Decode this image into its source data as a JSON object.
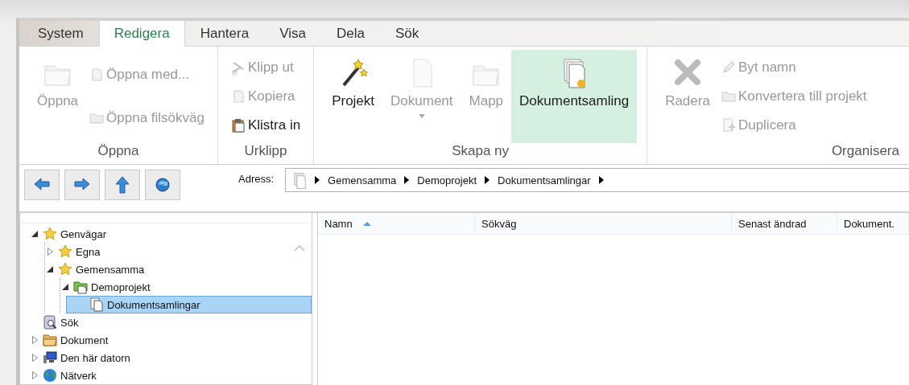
{
  "tabs": [
    {
      "label": "System",
      "selected": false
    },
    {
      "label": "Redigera",
      "selected": true
    },
    {
      "label": "Hantera",
      "selected": false
    },
    {
      "label": "Visa",
      "selected": false
    },
    {
      "label": "Dela",
      "selected": false
    },
    {
      "label": "Sök",
      "selected": false
    }
  ],
  "ribbon": {
    "groups": [
      {
        "label": "Öppna",
        "items": [
          {
            "kind": "large",
            "label": "Öppna",
            "disabled": true
          },
          {
            "kind": "stack",
            "items": [
              {
                "label": "Öppna med...",
                "disabled": true
              },
              {
                "label": "Öppna filsökväg",
                "disabled": true
              }
            ]
          }
        ]
      },
      {
        "label": "Urklipp",
        "items": [
          {
            "kind": "stack",
            "items": [
              {
                "label": "Klipp ut",
                "disabled": true
              },
              {
                "label": "Kopiera",
                "disabled": true
              },
              {
                "label": "Klistra in",
                "disabled": false
              }
            ]
          }
        ]
      },
      {
        "label": "Skapa ny",
        "items": [
          {
            "kind": "large",
            "label": "Projekt",
            "disabled": false,
            "selected": false
          },
          {
            "kind": "large",
            "label": "Dokument",
            "disabled": true,
            "selected": false,
            "dropdown": true
          },
          {
            "kind": "large",
            "label": "Mapp",
            "disabled": true,
            "selected": false
          },
          {
            "kind": "large",
            "label": "Dokumentsamling",
            "disabled": false,
            "selected": true
          }
        ]
      },
      {
        "label": "Organisera",
        "items": [
          {
            "kind": "large",
            "label": "Radera",
            "disabled": true
          },
          {
            "kind": "stack",
            "items": [
              {
                "label": "Byt namn",
                "disabled": true
              },
              {
                "label": "Konvertera till projekt",
                "disabled": true
              },
              {
                "label": "Duplicera",
                "disabled": true
              }
            ]
          }
        ]
      }
    ]
  },
  "address": {
    "label": "Adress:",
    "crumbs": [
      "Gemensamma",
      "Demoprojekt",
      "Dokumentsamlingar"
    ]
  },
  "tree": [
    {
      "label": "Genvägar",
      "expanded": true,
      "selected": false,
      "children": [
        {
          "label": "Egna",
          "expanded": false,
          "selected": false
        },
        {
          "label": "Gemensamma",
          "expanded": true,
          "selected": false,
          "children": [
            {
              "label": "Demoprojekt",
              "expanded": true,
              "selected": false,
              "children": [
                {
                  "label": "Dokumentsamlingar",
                  "selected": true
                }
              ]
            }
          ]
        }
      ]
    },
    {
      "label": "Sök",
      "selected": false
    },
    {
      "label": "Dokument",
      "expanded": false,
      "selected": false
    },
    {
      "label": "Den här datorn",
      "expanded": false,
      "selected": false
    },
    {
      "label": "Nätverk",
      "expanded": false,
      "selected": false
    }
  ],
  "table": {
    "columns": [
      {
        "label": "Namn",
        "sorted": true
      },
      {
        "label": "Sökväg",
        "sorted": false
      },
      {
        "label": "Senast ändrad",
        "sorted": false
      },
      {
        "label": "Dokument.",
        "sorted": false
      }
    ]
  }
}
